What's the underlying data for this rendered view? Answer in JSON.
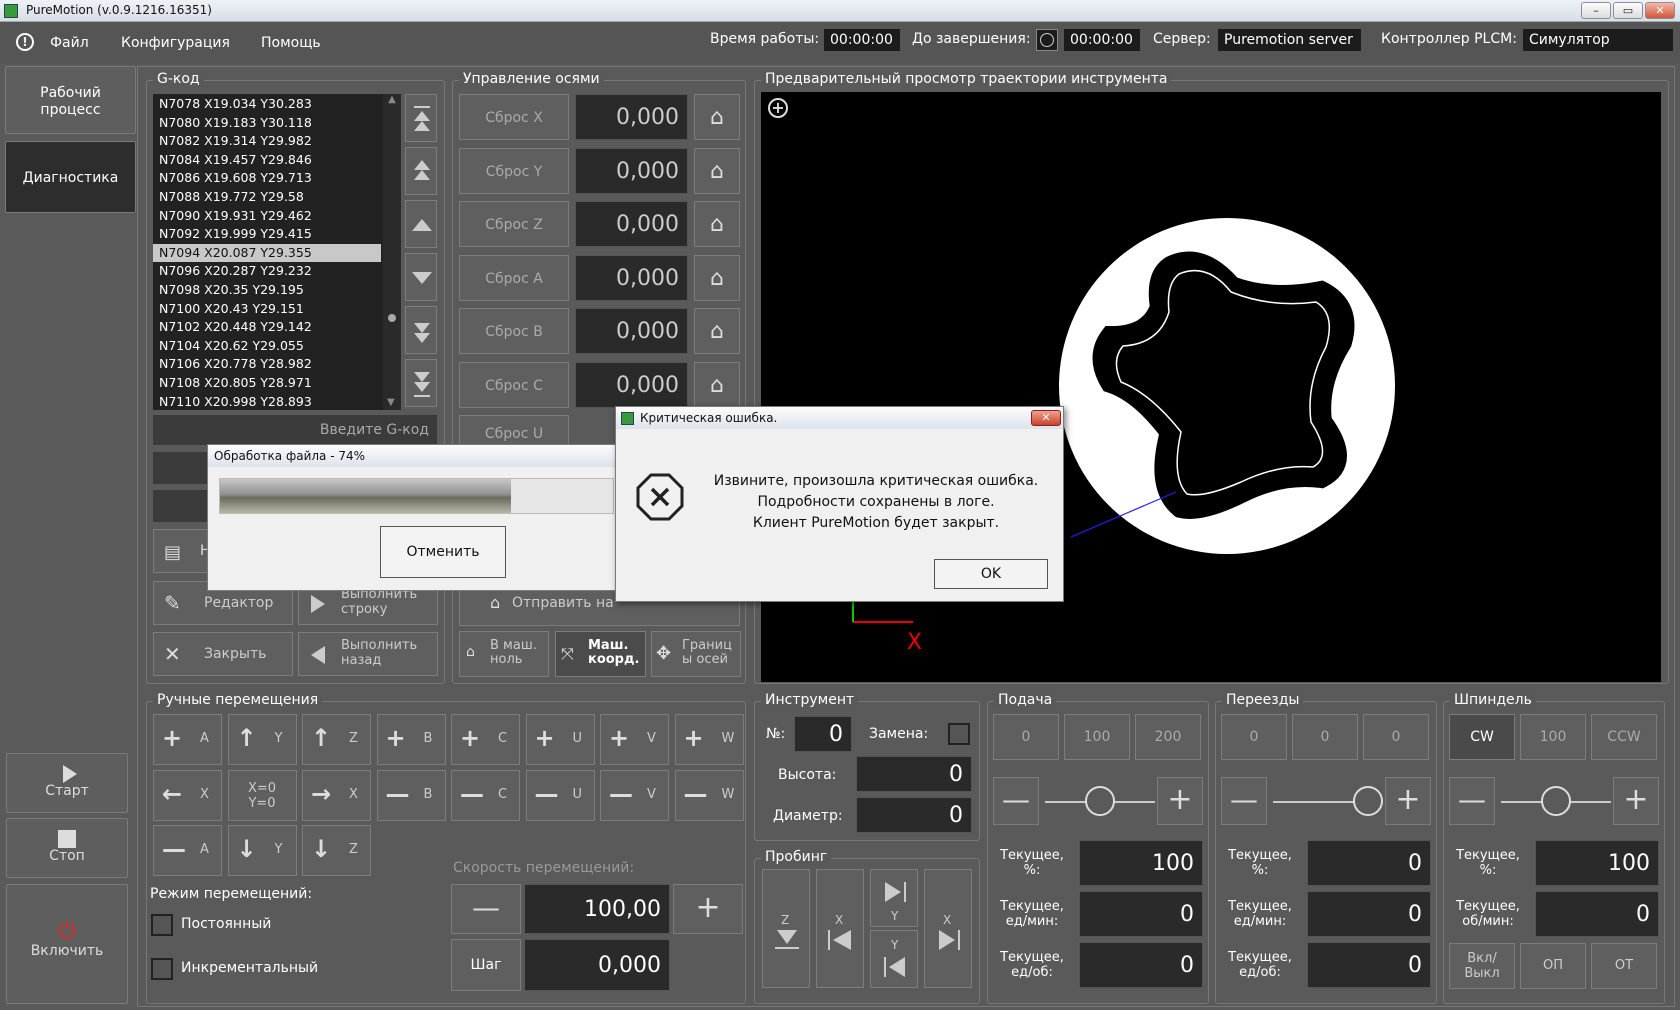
{
  "window": {
    "title": "PureMotion (v.0.9.1216.16351)"
  },
  "menu": {
    "file": "Файл",
    "config": "Конфигурация",
    "help": "Помощь"
  },
  "status": {
    "runtime_label": "Время работы:",
    "runtime_value": "00:00:00",
    "remaining_label": "До завершения:",
    "remaining_value": "00:00:00",
    "server_label": "Сервер:",
    "server_value": "Puremotion server",
    "plc_label": "Контроллер PLCM:",
    "plc_value": "Симулятор"
  },
  "sidebar": {
    "workflow": "Рабочий\nпроцесс",
    "diagnostics": "Диагностика",
    "start": "Старт",
    "stop": "Стоп",
    "enable": "Включить"
  },
  "gcode": {
    "title": "G-код",
    "lines": [
      "N7078 X19.034 Y30.283",
      "N7080 X19.183 Y30.118",
      "N7082 X19.314 Y29.982",
      "N7084 X19.457 Y29.846",
      "N7086 X19.608 Y29.713",
      "N7088 X19.772 Y29.58",
      "N7090 X19.931 Y29.462",
      "N7092 X19.999 Y29.415",
      "N7094 X20.087 Y29.355",
      "N7096 X20.287 Y29.232",
      "N7098 X20.35 Y29.195",
      "N7100 X20.43 Y29.151",
      "N7102 X20.448 Y29.142",
      "N7104 X20.62 Y29.055",
      "N7106 X20.778 Y28.982",
      "N7108 X20.805 Y28.971",
      "N7110 X20.998 Y28.893"
    ],
    "input_placeholder": "Введите G-код",
    "editor": "Редактор",
    "close": "Закрыть",
    "run_line": "Выполнить\nстроку",
    "run_back": "Выполнить\nназад",
    "partial_label": "Н"
  },
  "axes": {
    "title": "Управление осями",
    "rows": [
      {
        "label": "Сброс X",
        "value": "0,000"
      },
      {
        "label": "Сброс Y",
        "value": "0,000"
      },
      {
        "label": "Сброс Z",
        "value": "0,000"
      },
      {
        "label": "Сброс A",
        "value": "0,000"
      },
      {
        "label": "Сброс B",
        "value": "0,000"
      },
      {
        "label": "Сброс C",
        "value": "0,000"
      },
      {
        "label": "Сброс U",
        "value": ""
      }
    ],
    "send": "Отправить на",
    "machine_zero": "В маш.\nноль",
    "machine_coords": "Маш.\nкоорд.",
    "axis_limits": "Границ\nы осей"
  },
  "preview": {
    "title": "Предварительный просмотр траектории инструмента",
    "axis_x": "X"
  },
  "manual": {
    "title": "Ручные перемещения",
    "row1": [
      {
        "icon": "+",
        "axis": "A"
      },
      {
        "icon": "↑",
        "axis": "Y"
      },
      {
        "icon": "↑",
        "axis": "Z"
      },
      {
        "icon": "+",
        "axis": "B"
      },
      {
        "icon": "+",
        "axis": "C"
      },
      {
        "icon": "+",
        "axis": "U"
      },
      {
        "icon": "+",
        "axis": "V"
      },
      {
        "icon": "+",
        "axis": "W"
      }
    ],
    "row2": [
      {
        "icon": "←",
        "axis": "X"
      },
      {
        "icon": "",
        "axis": "X=0\nY=0"
      },
      {
        "icon": "→",
        "axis": "X"
      },
      {
        "icon": "—",
        "axis": "B"
      },
      {
        "icon": "—",
        "axis": "C"
      },
      {
        "icon": "—",
        "axis": "U"
      },
      {
        "icon": "—",
        "axis": "V"
      },
      {
        "icon": "—",
        "axis": "W"
      }
    ],
    "row3": [
      {
        "icon": "—",
        "axis": "A"
      },
      {
        "icon": "↓",
        "axis": "Y"
      },
      {
        "icon": "↓",
        "axis": "Z"
      }
    ],
    "mode_label": "Режим перемещений:",
    "constant": "Постоянный",
    "incremental": "Инкрементальный",
    "speed_label": "Скорость перемещений:",
    "speed_value": "100,00",
    "step_label": "Шаг",
    "step_value": "0,000"
  },
  "tool": {
    "title": "Инструмент",
    "num_label": "№:",
    "num_value": "0",
    "change_label": "Замена:",
    "height_label": "Высота:",
    "height_value": "0",
    "diameter_label": "Диаметр:",
    "diameter_value": "0"
  },
  "probing": {
    "title": "Пробинг"
  },
  "feed": {
    "title": "Подача",
    "presets": [
      "0",
      "100",
      "200"
    ],
    "current_pct_label": "Текущее,\n%:",
    "current_pct": "100",
    "current_min_label": "Текущее,\nед/мин:",
    "current_min": "0",
    "current_rev_label": "Текущее,\nед/об:",
    "current_rev": "0"
  },
  "rapid": {
    "title": "Переезды",
    "presets": [
      "0",
      "0",
      "0"
    ],
    "current_pct_label": "Текущее,\n%:",
    "current_pct": "0",
    "current_min_label": "Текущее,\nед/мин:",
    "current_min": "0",
    "current_rev_label": "Текущее,\nед/об:",
    "current_rev": "0"
  },
  "spindle": {
    "title": "Шпиндель",
    "presets": [
      "CW",
      "100",
      "CCW"
    ],
    "current_pct_label": "Текущее,\n%:",
    "current_pct": "100",
    "current_rpm_label": "Текущее,\nоб/мин:",
    "current_rpm": "0",
    "onoff": "Вкл/\nВыкл",
    "op": "ОП",
    "ot": "ОТ"
  },
  "progress_dialog": {
    "title": "Обработка файла - 74%",
    "cancel": "Отменить",
    "progress": 0.74
  },
  "error_dialog": {
    "title": "Критическая ошибка.",
    "line1": "Извините, произошла критическая ошибка.",
    "line2": "Подробности сохранены в логе.",
    "line3": "Клиент PureMotion будет закрыт.",
    "ok": "OK"
  }
}
